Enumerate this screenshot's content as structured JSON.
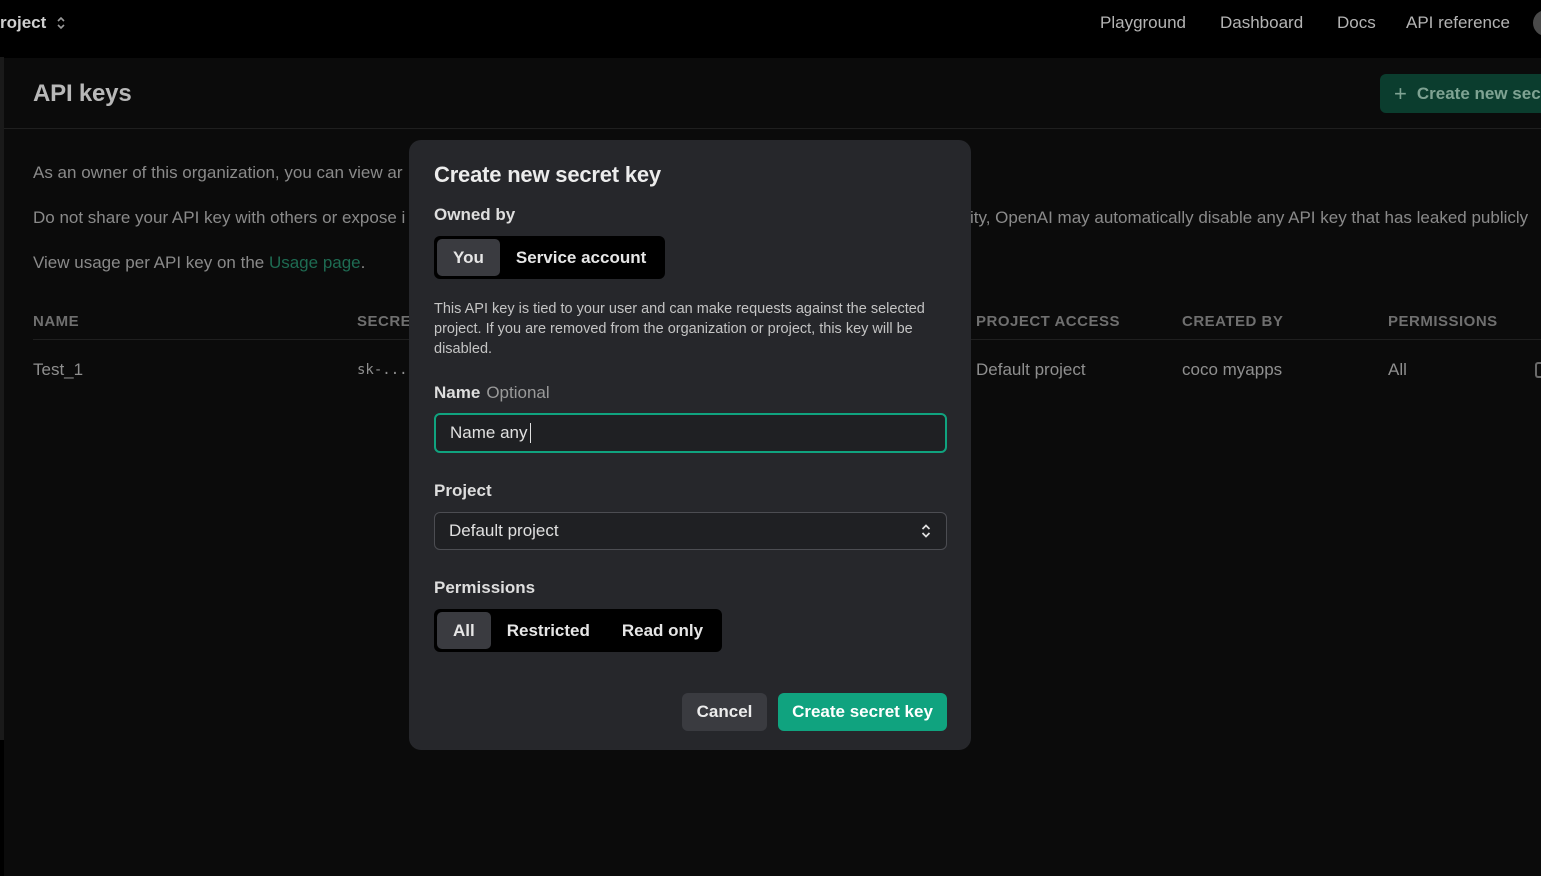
{
  "topbar": {
    "project_label": "roject",
    "nav": [
      "Playground",
      "Dashboard",
      "Docs",
      "API reference"
    ]
  },
  "page": {
    "title": "API keys",
    "create_button": "Create new sec",
    "desc1": "As an owner of this organization, you can view ar",
    "desc2_left": "Do not share your API key with others or expose i",
    "desc2_right": "ity, OpenAI may automatically disable any API key that has leaked publicly",
    "desc3_prefix": "View usage per API key on the ",
    "desc3_link": "Usage page",
    "desc3_suffix": "."
  },
  "table": {
    "headers": {
      "name": "NAME",
      "secret": "SECRE",
      "project_access": "PROJECT ACCESS",
      "created_by": "CREATED BY",
      "permissions": "PERMISSIONS"
    },
    "row": {
      "name": "Test_1",
      "secret": "sk-...",
      "project_access": "Default project",
      "created_by": "coco myapps",
      "permissions": "All"
    }
  },
  "modal": {
    "title": "Create new secret key",
    "owned_by_label": "Owned by",
    "owned_options": [
      "You",
      "Service account"
    ],
    "owned_selected": "You",
    "helper": "This API key is tied to your user and can make requests against the selected project. If you are removed from the organization or project, this key will be disabled.",
    "name_label": "Name",
    "name_optional": "Optional",
    "name_value": "Name any",
    "project_label": "Project",
    "project_value": "Default project",
    "permissions_label": "Permissions",
    "permission_options": [
      "All",
      "Restricted",
      "Read only"
    ],
    "permission_selected": "All",
    "cancel": "Cancel",
    "submit": "Create secret key"
  },
  "colors": {
    "accent": "#10a37f",
    "modal_bg": "#26272b",
    "link": "#1e6b52"
  }
}
